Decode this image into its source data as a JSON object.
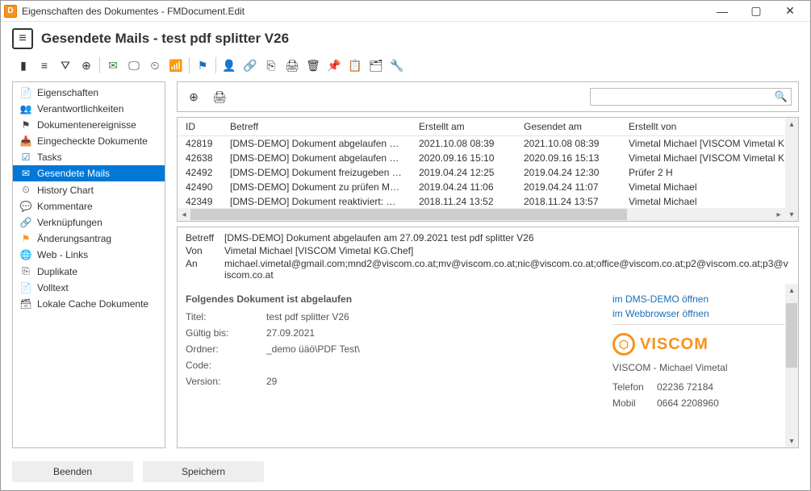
{
  "window": {
    "title": "Eigenschaften des Dokumentes - FMDocument.Edit"
  },
  "header": {
    "title": "Gesendete Mails - test pdf splitter V26"
  },
  "toolbar": {
    "items": [
      {
        "name": "db-icon",
        "glyph": "▮",
        "tip": "Datenbank"
      },
      {
        "name": "list-icon",
        "glyph": "≡",
        "tip": "Liste"
      },
      {
        "name": "filter-icon",
        "glyph": "⛛",
        "tip": "Filter"
      },
      {
        "name": "globe-icon",
        "glyph": "⊕",
        "tip": "Globus"
      },
      {
        "name": "sep",
        "sep": true
      },
      {
        "name": "mail-check-icon",
        "glyph": "✉",
        "tip": "Mail",
        "cls": "c-green"
      },
      {
        "name": "monitor-icon",
        "glyph": "🖵",
        "tip": "Monitor"
      },
      {
        "name": "clock-icon",
        "glyph": "⏲",
        "tip": "Uhr"
      },
      {
        "name": "broadcast-icon",
        "glyph": "📶",
        "tip": "Broadcast"
      },
      {
        "name": "sep2",
        "sep": true
      },
      {
        "name": "flag-icon",
        "glyph": "⚑",
        "tip": "Flagge",
        "cls": "c-blue"
      },
      {
        "name": "sep3",
        "sep": true
      },
      {
        "name": "user-icon",
        "glyph": "👤",
        "tip": "Benutzer"
      },
      {
        "name": "link-icon",
        "glyph": "🔗",
        "tip": "Link"
      },
      {
        "name": "copy-icon",
        "glyph": "⎘",
        "tip": "Kopieren"
      },
      {
        "name": "print-icon",
        "glyph": "🖨",
        "tip": "Drucken"
      },
      {
        "name": "trash-icon",
        "glyph": "🗑",
        "tip": "Löschen"
      },
      {
        "name": "pin-icon",
        "glyph": "📌",
        "tip": "Pin"
      },
      {
        "name": "clipboard-icon",
        "glyph": "📋",
        "tip": "Zwischenablage"
      },
      {
        "name": "card-icon",
        "glyph": "🗂",
        "tip": "Karte"
      },
      {
        "name": "wrench-icon",
        "glyph": "🔧",
        "tip": "Werkzeug"
      }
    ]
  },
  "sidebar": {
    "items": [
      {
        "icon": "📄",
        "label": "Eigenschaften"
      },
      {
        "icon": "👥",
        "label": "Verantwortlichkeiten",
        "cls": "c-green"
      },
      {
        "icon": "⚑",
        "label": "Dokumentenereignisse"
      },
      {
        "icon": "📥",
        "label": "Eingecheckte Dokumente"
      },
      {
        "icon": "☑",
        "label": "Tasks",
        "cls": "c-blue"
      },
      {
        "icon": "✉",
        "label": "Gesendete Mails",
        "active": true
      },
      {
        "icon": "⏲",
        "label": "History Chart"
      },
      {
        "icon": "💬",
        "label": "Kommentare"
      },
      {
        "icon": "🔗",
        "label": "Verknüpfungen",
        "cls": "c-red"
      },
      {
        "icon": "⚑",
        "label": "Änderungsantrag",
        "cls": "c-orange"
      },
      {
        "icon": "🌐",
        "label": "Web - Links"
      },
      {
        "icon": "⎘",
        "label": "Duplikate"
      },
      {
        "icon": "📄",
        "label": "Volltext"
      },
      {
        "icon": "🗃",
        "label": "Lokale Cache Dokumente"
      }
    ]
  },
  "filterbar": {
    "search_placeholder": ""
  },
  "table": {
    "headers": [
      "ID",
      "Betreff",
      "Erstellt am",
      "Gesendet am",
      "Erstellt von"
    ],
    "rows": [
      {
        "id": "42819",
        "betreff": "[DMS-DEMO] Dokument abgelaufen a...",
        "erstellt": "2021.10.08 08:39",
        "gesendet": "2021.10.08 08:39",
        "von": "Vimetal Michael [VISCOM Vimetal K"
      },
      {
        "id": "42638",
        "betreff": "[DMS-DEMO] Dokument abgelaufen a...",
        "erstellt": "2020.09.16 15:10",
        "gesendet": "2020.09.16 15:13",
        "von": "Vimetal Michael [VISCOM Vimetal K"
      },
      {
        "id": "42492",
        "betreff": "[DMS-DEMO] Dokument freizugeben M...",
        "erstellt": "2019.04.24 12:25",
        "gesendet": "2019.04.24 12:30",
        "von": "Prüfer 2 H"
      },
      {
        "id": "42490",
        "betreff": "[DMS-DEMO] Dokument zu prüfen MYC...",
        "erstellt": "2019.04.24 11:06",
        "gesendet": "2019.04.24 11:07",
        "von": "Vimetal Michael"
      },
      {
        "id": "42349",
        "betreff": "[DMS-DEMO] Dokument reaktiviert: MY...",
        "erstellt": "2018.11.24 13:52",
        "gesendet": "2018.11.24 13:57",
        "von": "Vimetal Michael"
      }
    ]
  },
  "detail": {
    "betreff_label": "Betreff",
    "betreff": "[DMS-DEMO] Dokument abgelaufen am 27.09.2021  test pdf splitter V26",
    "von_label": "Von",
    "von": "Vimetal Michael [VISCOM Vimetal KG.Chef]",
    "an_label": "An",
    "an": "michael.vimetal@gmail.com;mnd2@viscom.co.at;mv@viscom.co.at;nic@viscom.co.at;office@viscom.co.at;p2@viscom.co.at;p3@viscom.co.at",
    "doc": {
      "heading": "Folgendes Dokument ist abgelaufen",
      "titel_label": "Titel:",
      "titel": "test pdf splitter V26",
      "gueltig_label": "Gültig bis:",
      "gueltig": "27.09.2021",
      "ordner_label": "Ordner:",
      "ordner": "_demo üäö\\PDF Test\\",
      "code_label": "Code:",
      "code": "",
      "version_label": "Version:",
      "version": "29"
    },
    "links": {
      "dms": "im DMS-DEMO öffnen",
      "web": "im Webbrowser öffnen"
    },
    "contact": {
      "company": "VISCOM - Michael Vimetal",
      "tel_label": "Telefon",
      "tel": "02236 72184",
      "mob_label": "Mobil",
      "mob": "0664 2208960",
      "logo_text": "VISCOM"
    }
  },
  "footer": {
    "close": "Beenden",
    "save": "Speichern"
  }
}
